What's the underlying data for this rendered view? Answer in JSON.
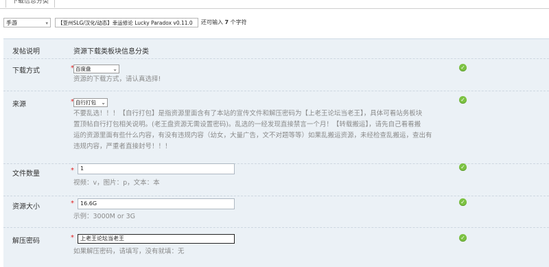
{
  "tab": {
    "label": "下载信息分类"
  },
  "subject": {
    "category": "手游",
    "title": "【亚州SLG/汉化/动态】幸运修论 Lucky Paradox v0.11.0",
    "remaining_prefix": "还可输入",
    "remaining_count": "7",
    "remaining_suffix": "个字符"
  },
  "form": {
    "description": {
      "label": "发帖说明",
      "value": "资源下载类板块信息分类"
    },
    "download_method": {
      "label": "下载方式",
      "required": "*",
      "selected": "百度盘",
      "hint": "资源的下载方式，请认真选择!"
    },
    "source": {
      "label": "来源",
      "required": "*",
      "selected": "自行打包",
      "hint_lines": [
        "不要乱选！！！【自行打包】是指资源里面含有了本站的宣传文件和解压密码为【上老王论坛当老王】，具体可看站务板块",
        "置顶帖自行打包相关说明。(老王盘资源无需设置密码)。乱选的一经发现直接禁言一个月！【转载搬运】，请先自己看看搬",
        "运的资源里面有些什么内容，有没有违规内容（幼女，大量广告，文不对题等等）如果乱搬运资源，未经检查乱搬运，查出有",
        "违规内容，严重者直接封号！！！"
      ]
    },
    "file_count": {
      "label": "文件数量",
      "required": "*",
      "value": "1",
      "hint": "视频：v，图片：p，文本：本"
    },
    "resource_size": {
      "label": "资源大小",
      "required": "*",
      "value": "16.6G",
      "hint": "示例：3000M or 3G"
    },
    "password": {
      "label": "解压密码",
      "required": "*",
      "value": "上老王论坛当老王",
      "hint": "如果解压密码，请填写，没有就填：无"
    }
  },
  "icons": {
    "ok": "check-circle-icon",
    "ok_color": "#7cc242",
    "required_color": "#e02020"
  }
}
